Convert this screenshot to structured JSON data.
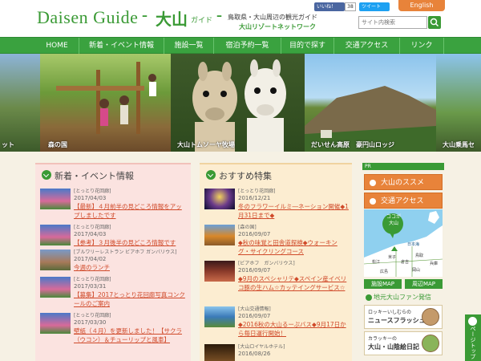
{
  "header": {
    "logo_en": "Daisen Guide",
    "logo_dash": "–",
    "logo_jp": "大山",
    "logo_sub": "ガイド",
    "logo_dash2": "–",
    "tagline": "鳥取県・大山周辺の観光ガイド",
    "tagline2": "大山リゾートネットワーク",
    "fb_like": "いいね！",
    "fb_count": "38",
    "tweet": "ツイート",
    "english": "English",
    "search_placeholder": "サイト内検索"
  },
  "nav": [
    "HOME",
    "新着・イベント情報",
    "施設一覧",
    "宿泊予約一覧",
    "目的で探す",
    "交通アクセス",
    "リンク"
  ],
  "banner": {
    "slides": [
      {
        "caption": "ット"
      },
      {
        "caption": "森の国"
      },
      {
        "caption": "大山トムソーヤ牧場"
      },
      {
        "caption": "だいせん高原　豪円山ロッジ"
      },
      {
        "caption": "大山乗馬セ"
      }
    ]
  },
  "news": {
    "heading": "新着・イベント情報",
    "items": [
      {
        "category": "[とっとり花回廊]",
        "date": "2017/04/03",
        "title": "【最新】４月前半の見どころ情報をアップしましたです"
      },
      {
        "category": "[とっとり花回廊]",
        "date": "2017/04/03",
        "title": "【参考】３月後半の見どころ情報です"
      },
      {
        "category": "[ブルワリーレストラン ビアホフ ガンバリウス]",
        "date": "2017/04/02",
        "title": "今週のランチ"
      },
      {
        "category": "[とっとり花回廊]",
        "date": "2017/03/31",
        "title": "【募集】2017とっとり花回廊写真コンクールのご案内"
      },
      {
        "category": "[とっとり花回廊]",
        "date": "2017/03/30",
        "title": "壁紙（４月）を更新しました！【サクラ（ウコン）＆チューリップと風車】"
      }
    ]
  },
  "featured": {
    "heading": "おすすめ特集",
    "items": [
      {
        "category": "[とっとり花回廊]",
        "date": "2016/12/21",
        "title": "冬のフラワーイルミ―ネーション開催◆1月31日まで◆"
      },
      {
        "category": "[森の国]",
        "date": "2016/09/07",
        "title": "◆秋の味覚と田舎道探検◆ウォーキング・サイクリングコース"
      },
      {
        "category": "[ビアホフ　ガンバリウス]",
        "date": "2016/09/07",
        "title": "◆9月のスペシャリテ◆スペイン産イベリコ豚の生ハム☆カッテイングサービス☆"
      },
      {
        "category": "[大山交通情報]",
        "date": "2016/09/07",
        "title": "◆2016秋の大山るーぷバス◆9月17日から毎日運行開始！"
      },
      {
        "category": "[大山ロイヤルホテル]",
        "date": "2016/08/26",
        "title": ""
      }
    ]
  },
  "sidebar": {
    "pr": "PR",
    "susume": "大山のススメ",
    "access": "交通アクセス",
    "map_bubble": "ココが大山",
    "map_labels": [
      "日本海",
      "鳥取",
      "米子",
      "松江",
      "岡山",
      "広島",
      "倉吉",
      "兵庫"
    ],
    "btn_map": "施設MAP",
    "btn_area": "周辺MAP",
    "fan_heading": "地元大山ファン発信",
    "fan1_small": "ロッキーいしむらの",
    "fan1_big": "ニュースフラッシュ",
    "fan2_small": "カラッキーの",
    "fan2_big": "大山・山陰絵日記"
  },
  "page_top": "ページトップ"
}
